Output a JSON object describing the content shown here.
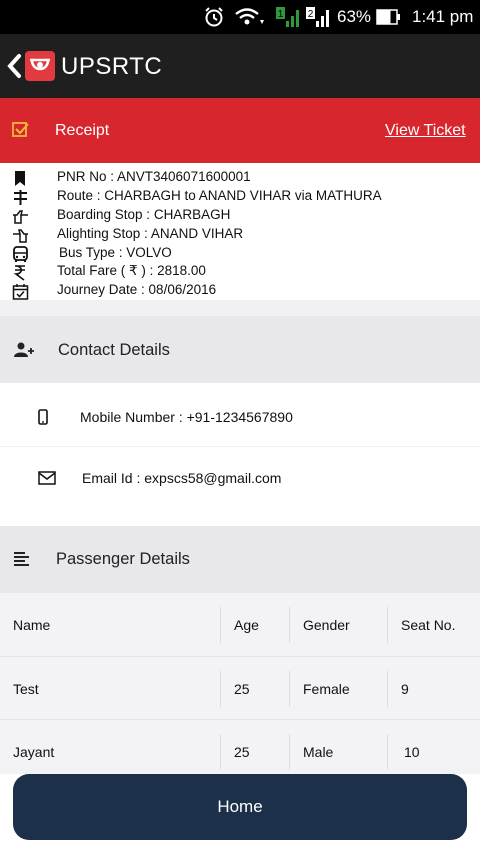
{
  "status_bar": {
    "battery": "63%",
    "time": "1:41 pm"
  },
  "app_bar": {
    "title": "UPSRTC"
  },
  "receipt_bar": {
    "title": "Receipt",
    "view_ticket": "View Ticket"
  },
  "booking": {
    "pnr": "PNR No : ANVT3406071600001",
    "route": "Route : CHARBAGH to ANAND VIHAR via MATHURA",
    "boarding": "Boarding Stop : CHARBAGH",
    "alighting": "Alighting Stop : ANAND VIHAR",
    "bus_type": "Bus Type : VOLVO",
    "total_fare": "Total Fare ( ₹ ) : 2818.00",
    "journey_date": "Journey Date : 08/06/2016"
  },
  "contact": {
    "title": "Contact Details",
    "mobile": "Mobile Number : +91-1234567890",
    "email": "Email Id : expscs58@gmail.com"
  },
  "passengers": {
    "title": "Passenger Details",
    "headers": [
      "Name",
      "Age",
      "Gender",
      "Seat No."
    ],
    "rows": [
      [
        "Test",
        "25",
        "Female",
        "9"
      ],
      [
        "Jayant",
        "25",
        "Male",
        "10"
      ]
    ]
  },
  "home_button": "Home"
}
